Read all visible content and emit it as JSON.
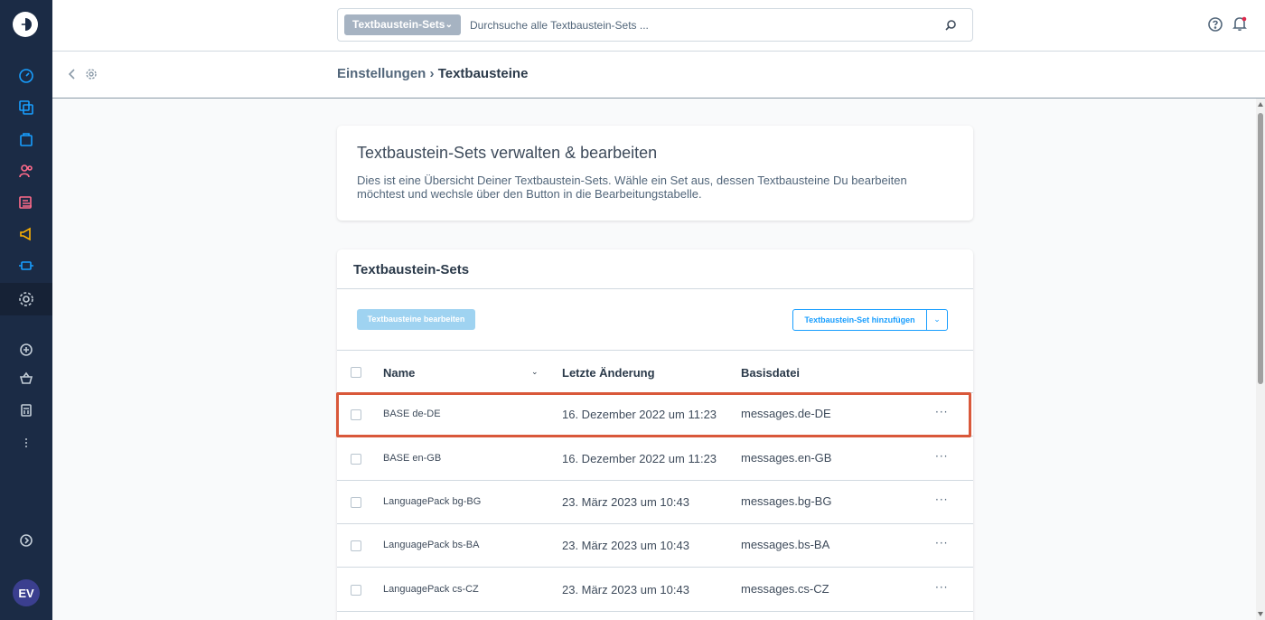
{
  "topbar": {
    "search_type": "Textbaustein-Sets",
    "search_placeholder": "Durchsuche alle Textbaustein-Sets ..."
  },
  "breadcrumb": {
    "parent": "Einstellungen",
    "separator": "›",
    "current": "Textbausteine"
  },
  "intro_card": {
    "title": "Textbaustein-Sets verwalten & bearbeiten",
    "description": "Dies ist eine Übersicht Deiner Textbaustein-Sets. Wähle ein Set aus, dessen Textbausteine Du bearbeiten möchtest und wechsle über den Button in die Bearbeitungstabelle."
  },
  "sets_card": {
    "title": "Textbaustein-Sets",
    "edit_button": "Textbausteine bearbeiten",
    "add_button": "Textbaustein-Set hinzufügen",
    "columns": [
      "Name",
      "Letzte Änderung",
      "Basisdatei"
    ],
    "rows": [
      {
        "name": "BASE de-DE",
        "date": "16. Dezember 2022 um 11:23",
        "file": "messages.de-DE"
      },
      {
        "name": "BASE en-GB",
        "date": "16. Dezember 2022 um 11:23",
        "file": "messages.en-GB"
      },
      {
        "name": "LanguagePack bg-BG",
        "date": "23. März 2023 um 10:43",
        "file": "messages.bg-BG"
      },
      {
        "name": "LanguagePack bs-BA",
        "date": "23. März 2023 um 10:43",
        "file": "messages.bs-BA"
      },
      {
        "name": "LanguagePack cs-CZ",
        "date": "23. März 2023 um 10:43",
        "file": "messages.cs-CZ"
      }
    ],
    "row_menu": "···"
  },
  "user": {
    "initials": "EV"
  },
  "colors": {
    "sidebar": "#1b2b45",
    "accent": "#189eff",
    "highlight": "#d9583a",
    "nav_icon": "#189eff",
    "marketing_icon": "#ffb200"
  }
}
